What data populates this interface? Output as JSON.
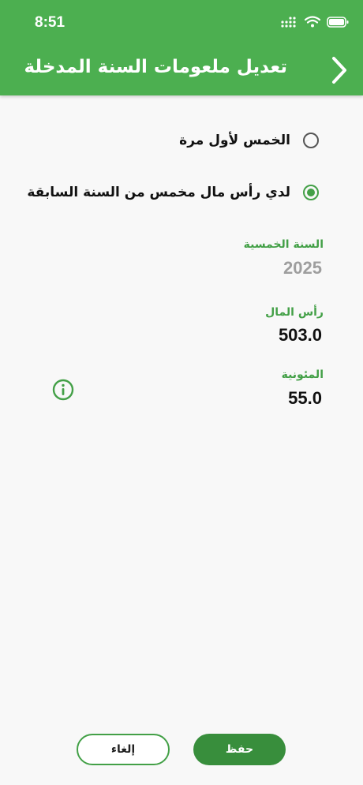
{
  "status_bar": {
    "time": "8:51",
    "icons": [
      "signal-icon",
      "wifi-icon",
      "battery-icon"
    ]
  },
  "header": {
    "title": "تعديل ملعومات السنة المدخلة",
    "back_icon": "chevron-right-icon"
  },
  "options": [
    {
      "label": "الخمس لأول مرة",
      "selected": false
    },
    {
      "label": "لدي رأس مال مخمس من السنة السابقة",
      "selected": true
    }
  ],
  "fields": {
    "year": {
      "label": "السنة الخمسية",
      "value": "2025"
    },
    "capital": {
      "label": "رأس المال",
      "value": "503.0"
    },
    "expenses": {
      "label": "المئونية",
      "value": "55.0",
      "info_icon": "info-icon"
    }
  },
  "buttons": {
    "save": "حفظ",
    "cancel": "إلغاء"
  },
  "colors": {
    "header_bg": "#4caf50",
    "accent": "#43a047",
    "save_bg": "#388e3c",
    "muted_value": "#9e9e9e"
  }
}
